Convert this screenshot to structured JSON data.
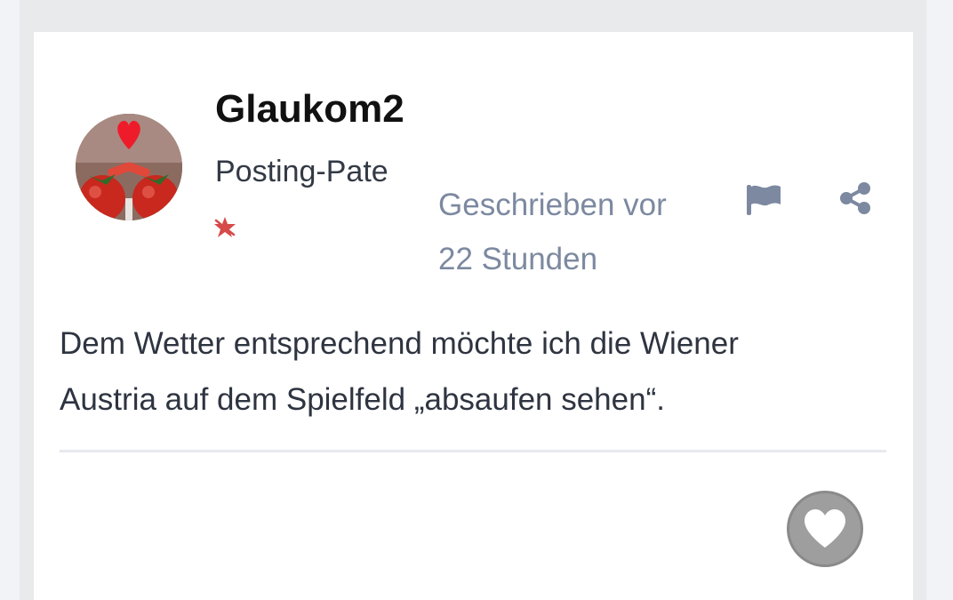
{
  "post": {
    "author": {
      "username": "Glaukom2",
      "rank": "Posting-Pate"
    },
    "timestamp_line1": "Geschrieben vor",
    "timestamp_line2": "22 Stunden",
    "body_line1": "Dem Wetter entsprechend möchte ich die Wiener",
    "body_line2": "Austria auf dem Spielfeld „absaufen sehen“."
  },
  "colors": {
    "accent": "#7c89a0",
    "like_button": "#9e9e9e",
    "rank_star": "#d64a4a"
  },
  "icons": {
    "report": "flag-icon",
    "share": "share-icon",
    "like": "heart-icon"
  }
}
